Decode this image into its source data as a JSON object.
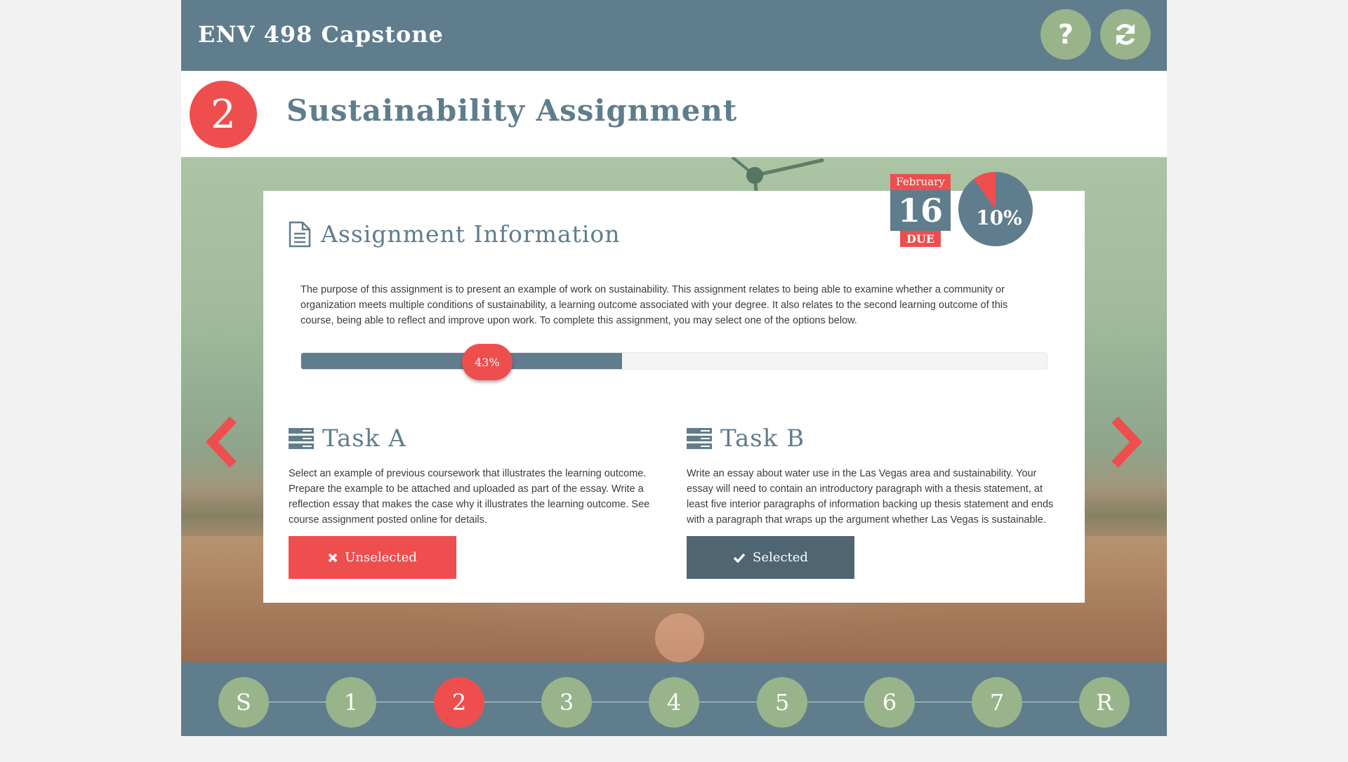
{
  "header": {
    "app_title": "ENV 498 Capstone",
    "help_label": "?"
  },
  "assignment": {
    "number": "2",
    "title": "Sustainability Assignment"
  },
  "info": {
    "heading": "Assignment Information",
    "description": "The purpose of this assignment is to present an example of work on sustainability. This assignment relates to being able to examine whether a community or organization meets multiple conditions of sustainability, a learning outcome associated with your degree. It also relates to the second learning outcome of this course, being able to reflect and improve upon work. To complete this assignment, you may select one of the options below.",
    "progress": 43,
    "progress_label": "43%"
  },
  "due": {
    "month": "February",
    "day": "16",
    "label": "DUE"
  },
  "weight": {
    "value": 10,
    "label": "10%"
  },
  "tasks": [
    {
      "title": "Task A",
      "description": "Select an example of previous coursework that illustrates the learning outcome. Prepare the example to be attached and uploaded as part of the essay. Write a reflection essay that makes the case why it illustrates the learning outcome. See course assignment posted online for details.",
      "button_label": "Unselected",
      "selected": false
    },
    {
      "title": "Task B",
      "description": "Write an essay about water use in the Las Vegas area and sustainability. Your essay will need to contain an introductory paragraph with a thesis statement, at least five interior paragraphs of information backing up thesis statement and ends with a paragraph that wraps up the argument whether Las Vegas is sustainable.",
      "button_label": "Selected",
      "selected": true
    }
  ],
  "steps": {
    "items": [
      "S",
      "1",
      "2",
      "3",
      "4",
      "5",
      "6",
      "7",
      "R"
    ],
    "active": "2"
  },
  "colors": {
    "slate": "#5f7d8c",
    "red": "#ef4e4e",
    "sage": "#99b48a",
    "dark_slate": "#4f6672"
  },
  "icons": {
    "help": "question-mark-icon",
    "refresh": "refresh-icon",
    "info": "document-icon",
    "task": "server-stack-icon",
    "unselected": "x-icon",
    "selected": "check-icon",
    "prev": "chevron-left-icon",
    "next": "chevron-right-icon"
  }
}
